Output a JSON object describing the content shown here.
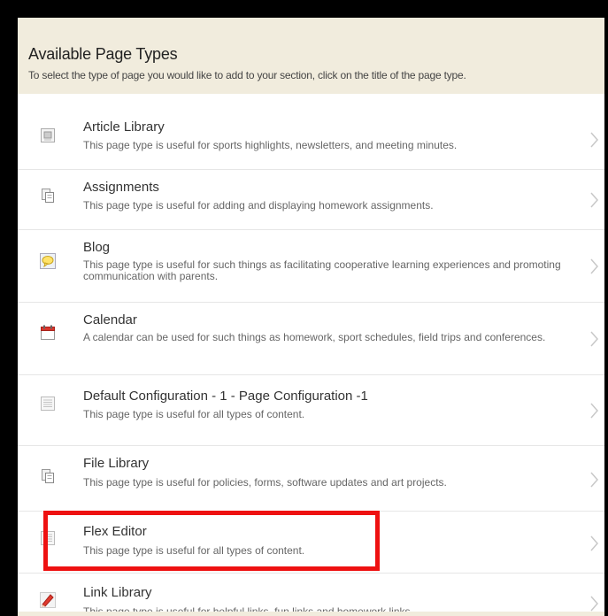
{
  "dialog": {
    "title": "Available Page Types",
    "subtitle": "To select the type of page you would like to add to your section, click on the title of the page type."
  },
  "page_types": [
    {
      "name": "Article Library",
      "description": "This page type is useful for sports highlights, newsletters, and meeting minutes.",
      "icon": "article-library-icon"
    },
    {
      "name": "Assignments",
      "description": "This page type is useful for adding and displaying homework assignments.",
      "icon": "assignments-icon"
    },
    {
      "name": "Blog",
      "description": "This page type is useful for such things as facilitating cooperative learning experiences and promoting communication with parents.",
      "icon": "blog-icon"
    },
    {
      "name": "Calendar",
      "description": "A calendar can be used for such things as homework, sport schedules, field trips and conferences.",
      "icon": "calendar-icon"
    },
    {
      "name": "Default Configuration - 1 - Page Configuration -1",
      "description": "This page type is useful for all types of content.",
      "icon": "page-icon"
    },
    {
      "name": "File Library",
      "description": "This page type is useful for policies, forms, software updates and art projects.",
      "icon": "file-library-icon"
    },
    {
      "name": "Flex Editor",
      "description": "This page type is useful for all types of content.",
      "icon": "page-icon",
      "highlighted": true
    },
    {
      "name": "Link Library",
      "description": "This page type is useful for helpful links, fun links and homework links.",
      "icon": "link-icon"
    }
  ],
  "colors": {
    "header_bg": "#f1ecdd",
    "highlight_border": "#ee1111"
  }
}
